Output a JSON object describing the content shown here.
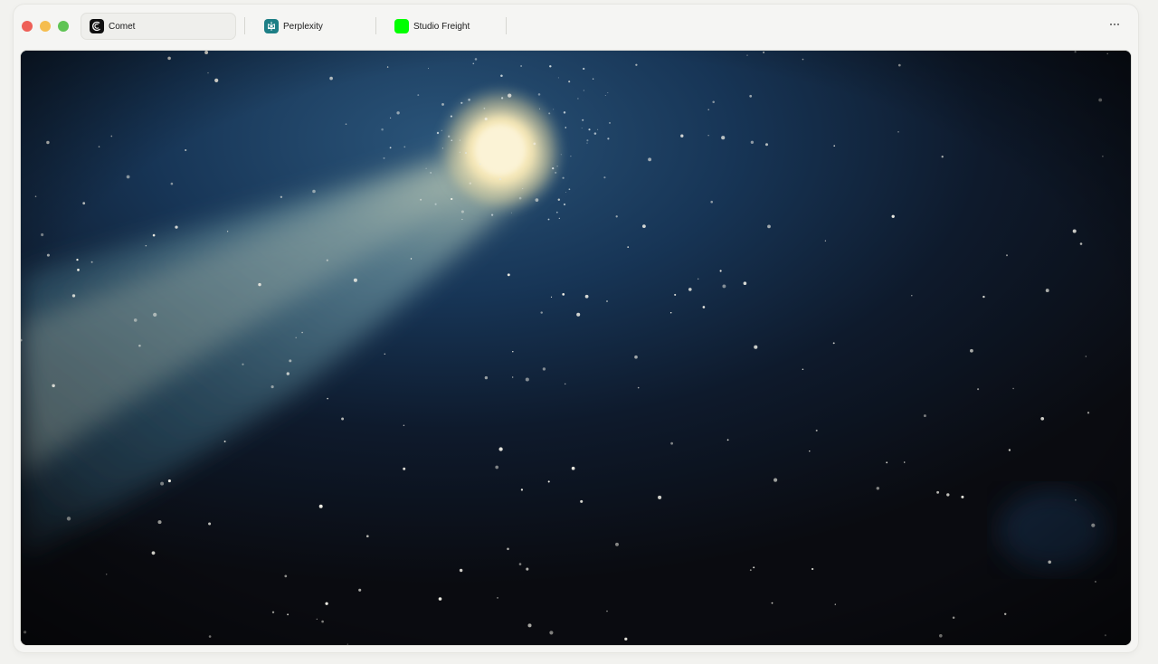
{
  "window": {
    "traffic_lights": [
      "close",
      "minimize",
      "maximize"
    ]
  },
  "tabs": [
    {
      "label": "Comet",
      "icon": "comet-icon",
      "active": true
    },
    {
      "label": "Perplexity",
      "icon": "perplexity-icon",
      "active": false
    },
    {
      "label": "Studio Freight",
      "icon": "studio-freight-icon",
      "active": false
    }
  ],
  "toolbar": {
    "more_icon": "more-horizontal-icon"
  },
  "content": {
    "image": "comet-night-sky-illustration"
  },
  "colors": {
    "close": "#ee5f57",
    "minimize": "#f5bd4f",
    "maximize": "#5fc454",
    "perplexity_icon_bg": "#1d7f86",
    "studio_freight_icon_bg": "#00ff00",
    "sky_dark": "#0a0b10",
    "sky_blue": "#1c3b5e",
    "comet_head": "#fbf2cf"
  }
}
